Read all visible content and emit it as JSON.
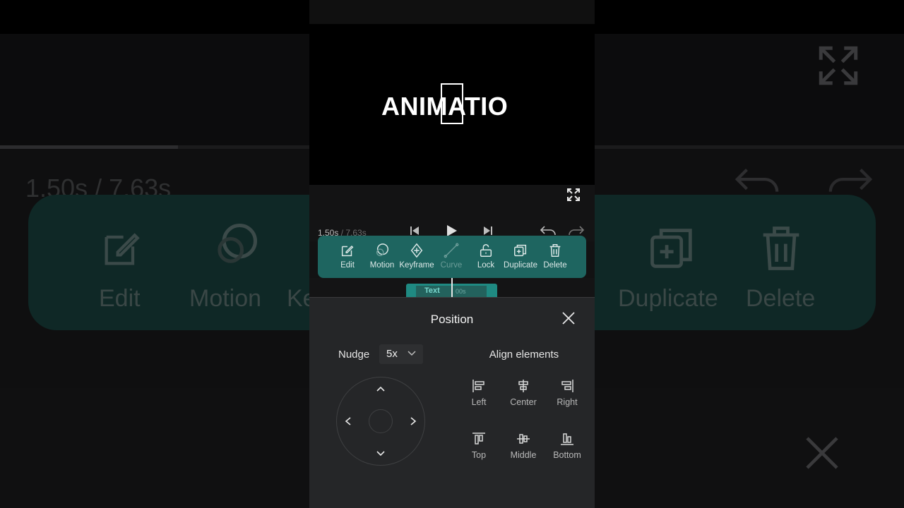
{
  "preview": {
    "text": "ANIMATIO"
  },
  "playback": {
    "current_time": "1.50s",
    "total_time": "/ 7.63s"
  },
  "toolbar": {
    "items": [
      {
        "label": "Edit",
        "icon": "edit-icon"
      },
      {
        "label": "Motion",
        "icon": "motion-icon"
      },
      {
        "label": "Keyframe",
        "icon": "keyframe-icon"
      },
      {
        "label": "Curve",
        "icon": "curve-icon",
        "disabled": true
      },
      {
        "label": "Lock",
        "icon": "lock-icon"
      },
      {
        "label": "Duplicate",
        "icon": "duplicate-icon"
      },
      {
        "label": "Delete",
        "icon": "delete-icon"
      }
    ]
  },
  "timeline": {
    "clip_label": "Text",
    "clip_duration": "00s"
  },
  "position_sheet": {
    "title": "Position",
    "nudge_label": "Nudge",
    "nudge_value": "5x",
    "align_title": "Align elements",
    "align_buttons": [
      {
        "label": "Left",
        "icon": "align-left-icon"
      },
      {
        "label": "Center",
        "icon": "align-center-icon"
      },
      {
        "label": "Right",
        "icon": "align-right-icon"
      },
      {
        "label": "Top",
        "icon": "align-top-icon"
      },
      {
        "label": "Middle",
        "icon": "align-middle-icon"
      },
      {
        "label": "Bottom",
        "icon": "align-bottom-icon"
      }
    ]
  },
  "background_ghost": {
    "time": "1.50s / 7.63s",
    "left_labels": [
      "Edit",
      "Motion",
      "Ke"
    ],
    "right_labels": [
      "Duplicate",
      "Delete"
    ]
  },
  "colors": {
    "toolbar_teal": "#1e6560",
    "clip_teal": "#1f8a82",
    "sheet_bg": "#252628"
  }
}
